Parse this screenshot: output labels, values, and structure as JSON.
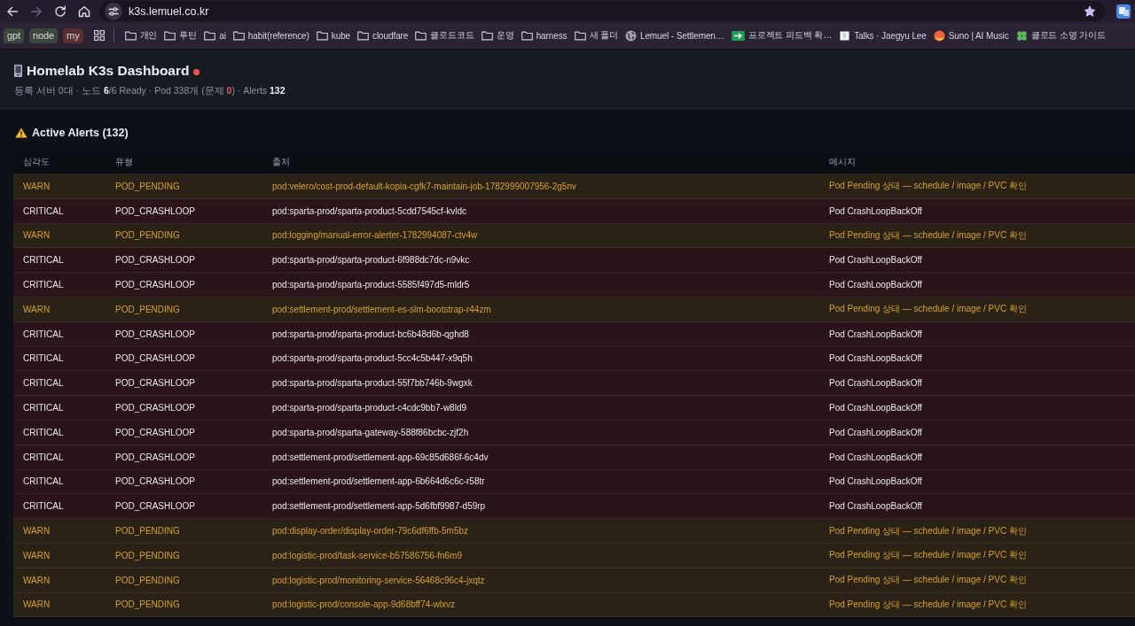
{
  "browser": {
    "url": "k3s.lemuel.co.kr",
    "forward_disabled": true,
    "bookmarked": true,
    "bookmark_tags": [
      {
        "label": "gpt",
        "color": "#3a4839"
      },
      {
        "label": "node",
        "color": "#3a4839"
      },
      {
        "label": "my",
        "color": "#58302f"
      }
    ],
    "bookmarks": [
      {
        "kind": "folder",
        "label": "개인"
      },
      {
        "kind": "folder",
        "label": "루틴"
      },
      {
        "kind": "folder",
        "label": "ai"
      },
      {
        "kind": "folder",
        "label": "habit(reference)"
      },
      {
        "kind": "folder",
        "label": "kube"
      },
      {
        "kind": "folder",
        "label": "cloudfare"
      },
      {
        "kind": "folder",
        "label": "클로드코드"
      },
      {
        "kind": "folder",
        "label": "운영"
      },
      {
        "kind": "folder",
        "label": "harness"
      },
      {
        "kind": "folder",
        "label": "새 폴더"
      },
      {
        "kind": "globe",
        "label": "Lemuel - Settlemen…"
      },
      {
        "kind": "sheet",
        "label": "프로젝트 피드백 확…"
      },
      {
        "kind": "page",
        "label": "Talks · Jaegyu Lee"
      },
      {
        "kind": "disc",
        "label": "Suno | AI Music"
      },
      {
        "kind": "clover",
        "label": "클로드 소명 가이드"
      }
    ]
  },
  "header": {
    "title": "Homelab K3s Dashboard",
    "healthy": false,
    "summary": [
      {
        "kind": "plain",
        "text": "등록 서버 0대 · 노드 "
      },
      {
        "kind": "strong",
        "text": "6"
      },
      {
        "kind": "plain",
        "text": "/6 Ready · Pod 338개 (문제 "
      },
      {
        "kind": "danger",
        "text": "0"
      },
      {
        "kind": "plain",
        "text": ") · Alerts "
      },
      {
        "kind": "strong",
        "text": "132"
      }
    ]
  },
  "alerts": {
    "title": "Active Alerts (132)",
    "columns": [
      "심각도",
      "유형",
      "출처",
      "메시지"
    ],
    "rows": [
      {
        "kind": "warn",
        "severity": "WARN",
        "type": "POD_PENDING",
        "source": "pod:velero/cost-prod-default-kopia-cgfk7-maintain-job-1782999007956-2g5nv",
        "message": "Pod Pending 상태 — schedule / image / PVC 확인"
      },
      {
        "kind": "critical",
        "severity": "CRITICAL",
        "type": "POD_CRASHLOOP",
        "source": "pod:sparta-prod/sparta-product-5cdd7545cf-kvldc",
        "message": "Pod CrashLoopBackOff"
      },
      {
        "kind": "warn",
        "severity": "WARN",
        "type": "POD_PENDING",
        "source": "pod:logging/manual-error-alerter-1782994087-ctv4w",
        "message": "Pod Pending 상태 — schedule / image / PVC 확인"
      },
      {
        "kind": "critical",
        "severity": "CRITICAL",
        "type": "POD_CRASHLOOP",
        "source": "pod:sparta-prod/sparta-product-6f988dc7dc-n9vkc",
        "message": "Pod CrashLoopBackOff"
      },
      {
        "kind": "critical",
        "severity": "CRITICAL",
        "type": "POD_CRASHLOOP",
        "source": "pod:sparta-prod/sparta-product-5585f497d5-mldr5",
        "message": "Pod CrashLoopBackOff"
      },
      {
        "kind": "warn",
        "severity": "WARN",
        "type": "POD_PENDING",
        "source": "pod:settlement-prod/settlement-es-slm-bootstrap-r44zm",
        "message": "Pod Pending 상태 — schedule / image / PVC 확인"
      },
      {
        "kind": "critical",
        "severity": "CRITICAL",
        "type": "POD_CRASHLOOP",
        "source": "pod:sparta-prod/sparta-product-bc6b48d6b-qghd8",
        "message": "Pod CrashLoopBackOff"
      },
      {
        "kind": "critical",
        "severity": "CRITICAL",
        "type": "POD_CRASHLOOP",
        "source": "pod:sparta-prod/sparta-product-5cc4c5b447-x9q5h",
        "message": "Pod CrashLoopBackOff"
      },
      {
        "kind": "critical",
        "severity": "CRITICAL",
        "type": "POD_CRASHLOOP",
        "source": "pod:sparta-prod/sparta-product-55f7bb746b-9wgxk",
        "message": "Pod CrashLoopBackOff"
      },
      {
        "kind": "critical",
        "severity": "CRITICAL",
        "type": "POD_CRASHLOOP",
        "source": "pod:sparta-prod/sparta-product-c4cdc9bb7-w8ld9",
        "message": "Pod CrashLoopBackOff"
      },
      {
        "kind": "critical",
        "severity": "CRITICAL",
        "type": "POD_CRASHLOOP",
        "source": "pod:sparta-prod/sparta-gateway-588f86bcbc-zjf2h",
        "message": "Pod CrashLoopBackOff"
      },
      {
        "kind": "critical",
        "severity": "CRITICAL",
        "type": "POD_CRASHLOOP",
        "source": "pod:settlement-prod/settlement-app-69c85d686f-6c4dv",
        "message": "Pod CrashLoopBackOff"
      },
      {
        "kind": "critical",
        "severity": "CRITICAL",
        "type": "POD_CRASHLOOP",
        "source": "pod:settlement-prod/settlement-app-6b664d6c6c-r58tr",
        "message": "Pod CrashLoopBackOff"
      },
      {
        "kind": "critical",
        "severity": "CRITICAL",
        "type": "POD_CRASHLOOP",
        "source": "pod:settlement-prod/settlement-app-5d6fbf9987-d59rp",
        "message": "Pod CrashLoopBackOff"
      },
      {
        "kind": "warn",
        "severity": "WARN",
        "type": "POD_PENDING",
        "source": "pod:display-order/display-order-79c6df6ffb-5m5bz",
        "message": "Pod Pending 상태 — schedule / image / PVC 확인"
      },
      {
        "kind": "warn",
        "severity": "WARN",
        "type": "POD_PENDING",
        "source": "pod:logistic-prod/task-service-b57586756-fn6m9",
        "message": "Pod Pending 상태 — schedule / image / PVC 확인"
      },
      {
        "kind": "warn",
        "severity": "WARN",
        "type": "POD_PENDING",
        "source": "pod:logistic-prod/monitoring-service-56468c96c4-jxqtz",
        "message": "Pod Pending 상태 — schedule / image / PVC 확인"
      },
      {
        "kind": "warn",
        "severity": "WARN",
        "type": "POD_PENDING",
        "source": "pod:logistic-prod/console-app-9d68bff74-wlxvz",
        "message": "Pod Pending 상태 — schedule / image / PVC 확인"
      }
    ]
  }
}
